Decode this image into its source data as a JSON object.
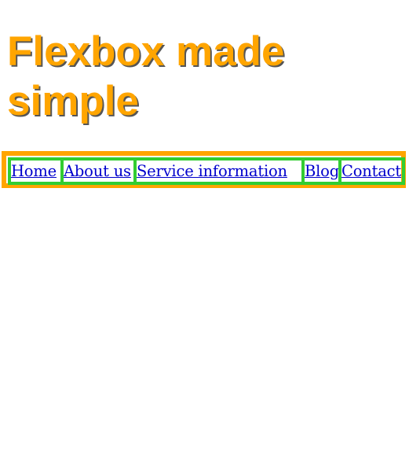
{
  "heading": {
    "title": "Flexbox made simple"
  },
  "nav": {
    "items": [
      {
        "label": "Home"
      },
      {
        "label": "About us"
      },
      {
        "label": "Service information"
      },
      {
        "label": "Blog"
      },
      {
        "label": "Contact"
      }
    ]
  },
  "colors": {
    "heading": "#ffa500",
    "heading_shadow": "#555555",
    "nav_border": "#ffa500",
    "item_border": "#32cd32",
    "link": "#0000cc"
  }
}
